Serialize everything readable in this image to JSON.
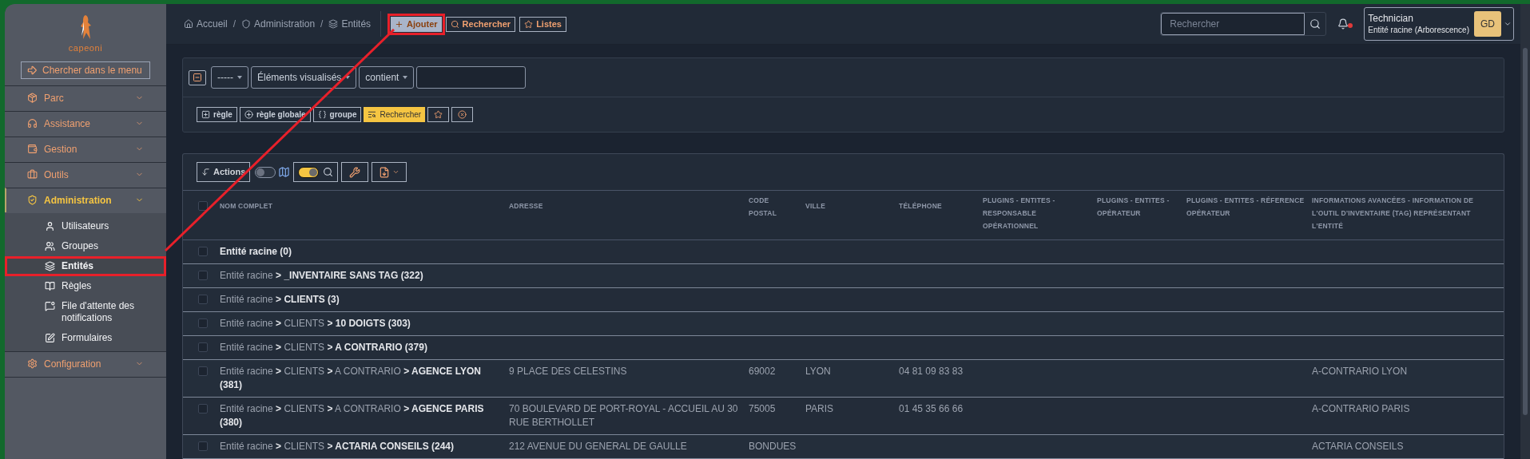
{
  "sidebar": {
    "logo_text": "capeoni",
    "menu_search": "Chercher dans le menu",
    "items": [
      {
        "label": "Parc",
        "expanded": false,
        "selected": false
      },
      {
        "label": "Assistance",
        "expanded": false,
        "selected": false
      },
      {
        "label": "Gestion",
        "expanded": false,
        "selected": false
      },
      {
        "label": "Outils",
        "expanded": false,
        "selected": false
      },
      {
        "label": "Administration",
        "expanded": true,
        "selected": true,
        "children": [
          {
            "label": "Utilisateurs",
            "selected": false,
            "highlighted": false
          },
          {
            "label": "Groupes",
            "selected": false,
            "highlighted": false
          },
          {
            "label": "Entités",
            "selected": true,
            "highlighted": true
          },
          {
            "label": "Règles",
            "selected": false,
            "highlighted": false
          },
          {
            "label": "File d'attente des notifications",
            "selected": false,
            "highlighted": false
          },
          {
            "label": "Formulaires",
            "selected": false,
            "highlighted": false
          }
        ]
      },
      {
        "label": "Configuration",
        "expanded": false,
        "selected": false
      }
    ]
  },
  "breadcrumbs": {
    "separator": "/",
    "items": [
      "Accueil",
      "Administration",
      "Entités"
    ]
  },
  "header_buttons": [
    {
      "label": "Ajouter",
      "highlighted": true
    },
    {
      "label": "Rechercher",
      "highlighted": false
    },
    {
      "label": "Listes",
      "highlighted": false
    }
  ],
  "global_search": {
    "placeholder": "Rechercher"
  },
  "notifications": {
    "unread": true
  },
  "user": {
    "profile": "Technician",
    "entity": "Entité racine (Arborescence)",
    "initials": "GD"
  },
  "filter": {
    "field": "-----",
    "item_type": "Éléments visualisés",
    "operator": "contient",
    "buttons": [
      "règle",
      "règle globale",
      "groupe",
      "Rechercher"
    ]
  },
  "toolbar": {
    "actions": "Actions",
    "map_toggle": {
      "on": false
    },
    "search_toggle": {
      "on": true
    }
  },
  "table": {
    "all_checked": false,
    "columns": [
      "NOM COMPLET",
      "ADRESSE",
      "CODE POSTAL",
      "VILLE",
      "TÉLÉPHONE",
      "PLUGINS - ENTITES - RESPONSABLE OPÉRATIONNEL",
      "PLUGINS - ENTITES - OPÉRATEUR",
      "PLUGINS - ENTITES - RÉFERENCE OPÉRATEUR",
      "INFORMATIONS AVANCÉES - INFORMATION DE L'OUTIL D'INVENTAIRE (TAG) REPRÉSENTANT L'ENTITÉ"
    ],
    "rows": [
      {
        "kind": "root",
        "checked": false,
        "name": "Entité racine (0)"
      },
      {
        "kind": "child",
        "checked": false,
        "name": "Entité racine **> _INVENTAIRE SANS TAG (322)**"
      },
      {
        "kind": "child",
        "checked": false,
        "name": "Entité racine **> CLIENTS (3)**"
      },
      {
        "kind": "child",
        "checked": false,
        "name": "Entité racine **>** CLIENTS **> 10 DOIGTS (303)**"
      },
      {
        "kind": "child",
        "checked": false,
        "name": "Entité racine **>** CLIENTS **> A CONTRARIO (379)**"
      },
      {
        "kind": "child",
        "checked": false,
        "name": "Entité racine **>** CLIENTS **>** A CONTRARIO **> AGENCE LYON (381)**",
        "address": "9 PLACE DES CELESTINS",
        "zip": "69002",
        "city": "LYON",
        "phone": "04 81 09 83 83",
        "tag": "A-CONTRARIO LYON"
      },
      {
        "kind": "child",
        "checked": false,
        "name": "Entité racine **>** CLIENTS **>** A CONTRARIO **> AGENCE PARIS (380)**",
        "address": "70 BOULEVARD DE PORT-ROYAL - ACCUEIL AU 30 RUE BERTHOLLET",
        "zip": "75005",
        "city": "PARIS",
        "phone": "01 45 35 66 66",
        "tag": "A-CONTRARIO PARIS"
      },
      {
        "kind": "child",
        "checked": false,
        "name": "Entité racine **>** CLIENTS **> ACTARIA CONSEILS (244)**",
        "address": "212 AVENUE DU GENERAL DE GAULLE",
        "zip": "BONDUES",
        "tag": "ACTARIA CONSEILS"
      }
    ]
  }
}
